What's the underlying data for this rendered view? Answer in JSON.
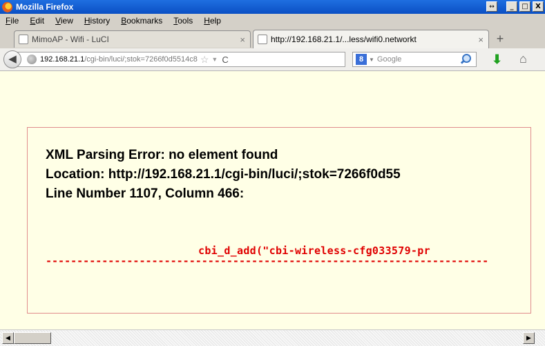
{
  "window": {
    "title": "Mozilla Firefox",
    "restore_symbol": "↔",
    "min_symbol": "_",
    "max_symbol": "□",
    "close_symbol": "X"
  },
  "menu": [
    "File",
    "Edit",
    "View",
    "History",
    "Bookmarks",
    "Tools",
    "Help"
  ],
  "tabs": [
    {
      "label": "MimoAP - Wifi - LuCI",
      "close": "×",
      "active": false
    },
    {
      "label": "http://192.168.21.1/...less/wifi0.networkt",
      "close": "×",
      "active": true
    }
  ],
  "newtab": "+",
  "nav": {
    "back": "◀",
    "url_host": "192.168.21.1",
    "url_path": "/cgi-bin/luci/;stok=7266f0d5514c8",
    "star": "☆",
    "drop": "▼",
    "reload": "C",
    "search_engine": "8",
    "search_drop": "▼",
    "search_placeholder": "Google",
    "download": "⬇",
    "home": "⌂"
  },
  "error": {
    "line1": "XML Parsing Error: no element found",
    "line2": "Location: http://192.168.21.1/cgi-bin/luci/;stok=7266f0d55",
    "line3": "Line Number 1107, Column 466:",
    "source": "cbi_d_add(\"cbi-wireless-cfg033579-pr",
    "dashes": "-----------------------------------------------------------------------"
  },
  "scroll": {
    "left": "◀",
    "right": "▶"
  }
}
